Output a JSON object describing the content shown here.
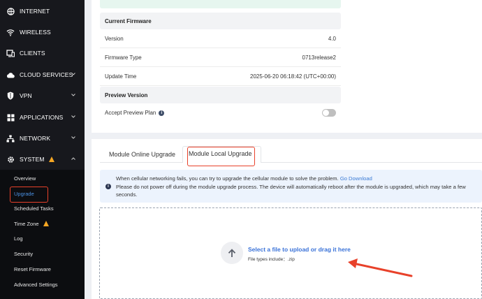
{
  "sidebar": {
    "items": [
      {
        "label": "INTERNET",
        "icon": "globe-icon"
      },
      {
        "label": "WIRELESS",
        "icon": "wifi-icon"
      },
      {
        "label": "CLIENTS",
        "icon": "clients-icon"
      },
      {
        "label": "CLOUD SERVICES",
        "icon": "cloud-icon"
      },
      {
        "label": "VPN",
        "icon": "shield-icon"
      },
      {
        "label": "APPLICATIONS",
        "icon": "apps-icon"
      },
      {
        "label": "NETWORK",
        "icon": "network-icon"
      },
      {
        "label": "SYSTEM",
        "icon": "gear-icon"
      }
    ],
    "system_sub": [
      {
        "label": "Overview"
      },
      {
        "label": "Upgrade"
      },
      {
        "label": "Scheduled Tasks"
      },
      {
        "label": "Time Zone"
      },
      {
        "label": "Log"
      },
      {
        "label": "Security"
      },
      {
        "label": "Reset Firmware"
      },
      {
        "label": "Advanced Settings"
      }
    ]
  },
  "firmware": {
    "current_heading": "Current Firmware",
    "rows": [
      {
        "label": "Version",
        "value": "4.0"
      },
      {
        "label": "Firmware Type",
        "value": "0713release2"
      },
      {
        "label": "Update Time",
        "value": "2025-06-20 06:18:42 (UTC+00:00)"
      }
    ],
    "preview_heading": "Preview Version",
    "preview_label": "Accept Preview Plan"
  },
  "module": {
    "tabs": [
      {
        "label": "Module Online Upgrade"
      },
      {
        "label": "Module Local Upgrade"
      }
    ],
    "info_line1": "When cellular networking fails, you can try to upgrade the cellular module to solve the problem.",
    "info_link": "Go Download",
    "info_line2": "Please do not power off during the module upgrade process. The device will automatically reboot after the module is upgraded, which may take a few seconds.",
    "drop_title": "Select a file to upload or drag it here",
    "drop_sub": "File types include：.zip"
  },
  "colors": {
    "sidebar_bg": "#17181d",
    "accent": "#3a72d8",
    "annotation": "#e8412a",
    "warning": "#f5a623"
  }
}
